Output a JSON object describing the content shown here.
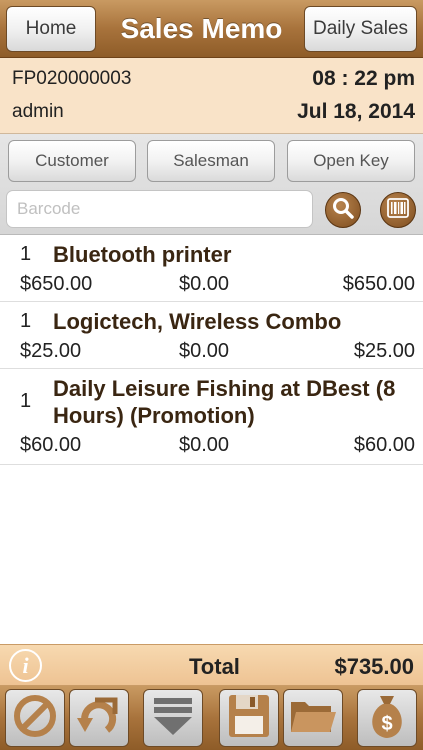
{
  "header": {
    "title": "Sales Memo",
    "home_label": "Home",
    "daily_sales_label": "Daily Sales"
  },
  "memo": {
    "number": "FP020000003",
    "time": "08 : 22 pm",
    "user": "admin",
    "date": "Jul 18, 2014"
  },
  "actions": {
    "customer_label": "Customer",
    "salesman_label": "Salesman",
    "open_key_label": "Open Key",
    "barcode_placeholder": "Barcode"
  },
  "items": [
    {
      "qty": "1",
      "name": "Bluetooth printer",
      "price": "$650.00",
      "discount": "$0.00",
      "total": "$650.00"
    },
    {
      "qty": "1",
      "name": "Logictech, Wireless Combo",
      "price": "$25.00",
      "discount": "$0.00",
      "total": "$25.00"
    },
    {
      "qty": "1",
      "name": "Daily Leisure Fishing at DBest (8 Hours)  (Promotion)",
      "price": "$60.00",
      "discount": "$0.00",
      "total": "$60.00"
    }
  ],
  "footer": {
    "total_label": "Total",
    "total_value": "$735.00"
  },
  "toolbar": {
    "icons": [
      "void-icon",
      "return-icon",
      "collapse-icon",
      "save-icon",
      "open-folder-icon",
      "payment-icon"
    ]
  },
  "colors": {
    "brand_brown": "#a8733c",
    "info_bg": "#f9e3c8",
    "item_name": "#3a2612"
  }
}
